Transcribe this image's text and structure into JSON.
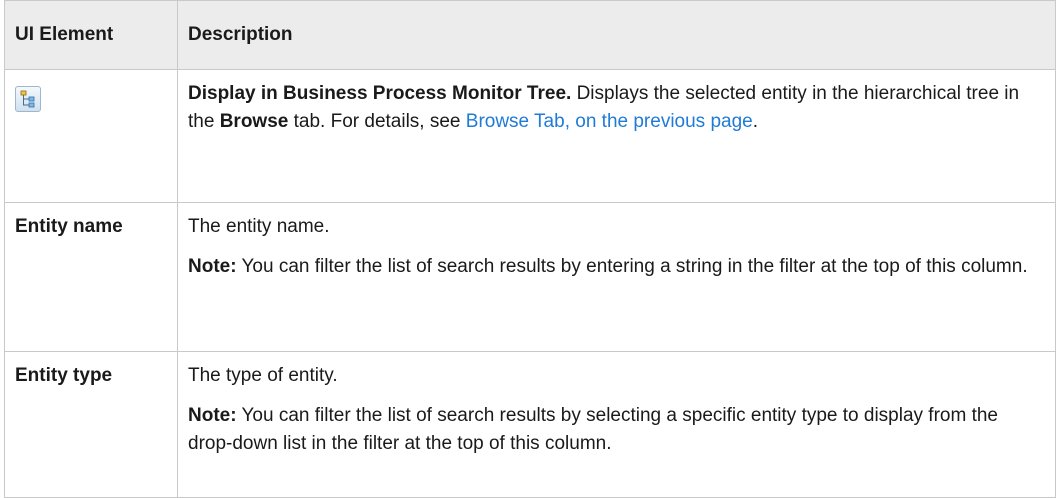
{
  "table": {
    "headers": [
      "UI Element",
      "Description"
    ],
    "rows": [
      {
        "element_icon": "tree-hierarchy-icon",
        "desc_bold": "Display in Business Process Monitor Tree.",
        "desc_text1": " Displays the selected entity in the hierarchical tree in the ",
        "desc_bold2": "Browse",
        "desc_text2": " tab. For details, see ",
        "desc_link": "Browse Tab, on the previous page",
        "desc_text3": "."
      },
      {
        "element": "Entity name",
        "desc": "The entity name.",
        "note_label": "Note:",
        "note_text": " You can filter the list of search results by entering a string in the filter at the top of this column."
      },
      {
        "element": "Entity type",
        "desc": "The type of entity.",
        "note_label": "Note:",
        "note_text": " You can filter the list of search results by selecting a specific entity type to display from the drop-down list in the filter at the top of this column."
      }
    ]
  },
  "colors": {
    "link": "#1f7bd6",
    "header_bg": "#ececec",
    "border": "#c9c9c9"
  }
}
